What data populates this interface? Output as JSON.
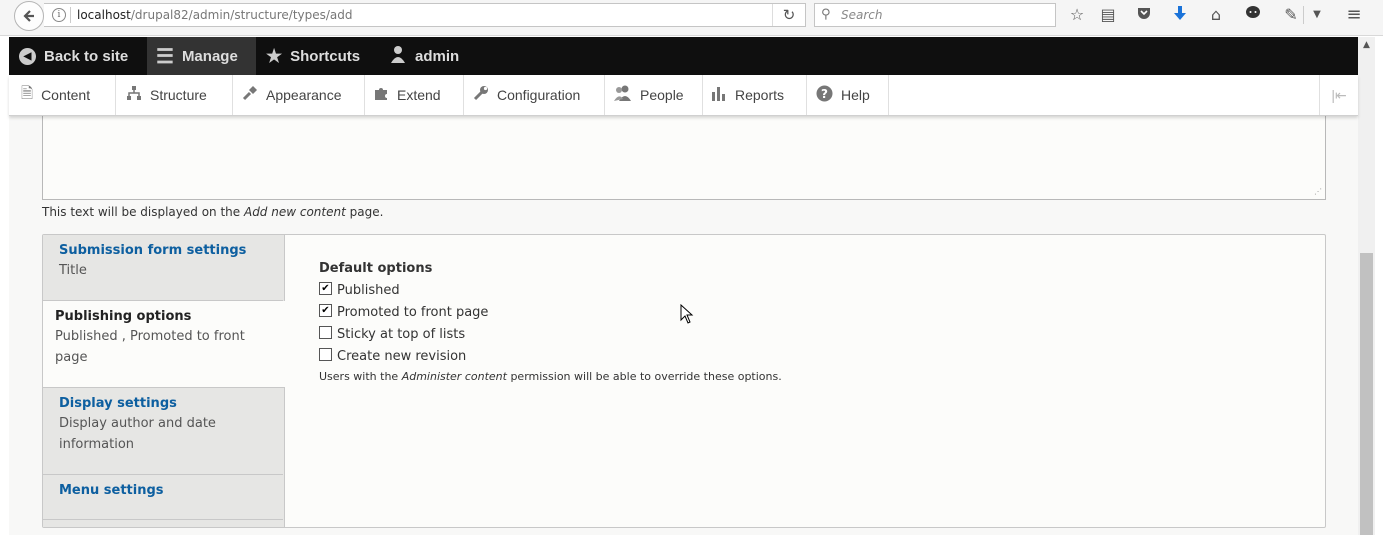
{
  "browser": {
    "url_host": "localhost",
    "url_path": "/drupal82/admin/structure/types/add",
    "search_placeholder": "Search",
    "info_glyph": "i"
  },
  "toolbar": {
    "back_to_site": "Back to site",
    "manage": "Manage",
    "shortcuts": "Shortcuts",
    "user": "admin"
  },
  "tray": {
    "items": [
      "Content",
      "Structure",
      "Appearance",
      "Extend",
      "Configuration",
      "People",
      "Reports",
      "Help"
    ]
  },
  "help_text": {
    "before": "This text will be displayed on the ",
    "emphasis": "Add new content",
    "after": " page."
  },
  "vertical_tabs": [
    {
      "title": "Submission form settings",
      "summary": "Title"
    },
    {
      "title": "Publishing options",
      "summary": "Published , Promoted to front page"
    },
    {
      "title": "Display settings",
      "summary": "Display author and date information"
    },
    {
      "title": "Menu settings",
      "summary": ""
    }
  ],
  "publishing": {
    "label": "Default options",
    "options": [
      {
        "label": "Published",
        "checked": true
      },
      {
        "label": "Promoted to front page",
        "checked": true
      },
      {
        "label": "Sticky at top of lists",
        "checked": false
      },
      {
        "label": "Create new revision",
        "checked": false
      }
    ],
    "desc_before": "Users with the ",
    "desc_emphasis": "Administer content",
    "desc_after": " permission will be able to override these options."
  },
  "colors": {
    "toolbar_bg": "#0f0f0f",
    "link_blue": "#0d5fa0",
    "active_tab": "#333333"
  }
}
